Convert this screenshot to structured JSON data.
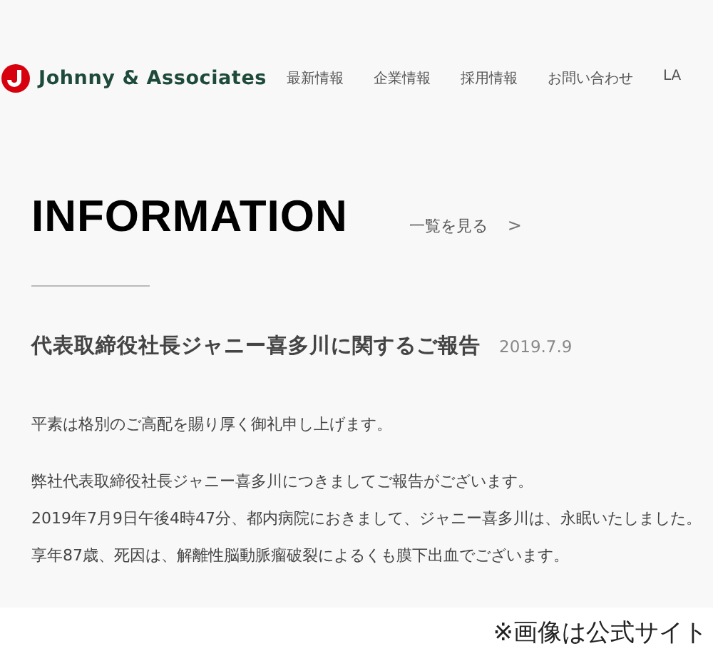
{
  "header": {
    "logo_text": "Johnny & Associates",
    "nav": [
      {
        "label": "最新情報"
      },
      {
        "label": "企業情報"
      },
      {
        "label": "採用情報"
      },
      {
        "label": "お問い合わせ"
      },
      {
        "label": "LA"
      }
    ]
  },
  "section": {
    "heading": "INFORMATION",
    "list_link": "一覧を見る",
    "list_link_arrow": ">"
  },
  "article": {
    "title": "代表取締役社長ジャニー喜多川に関するご報告",
    "date": "2019.7.9",
    "paragraphs": [
      [
        "平素は格別のご高配を賜り厚く御礼申し上げます。"
      ],
      [
        "弊社代表取締役社長ジャニー喜多川につきましてご報告がございます。",
        "2019年7月9日午後4時47分、都内病院におきまして、ジャニー喜多川は、永眠いたしました。",
        "享年87歳、死因は、解離性脳動脈瘤破裂によるくも膜下出血でございます。"
      ]
    ]
  },
  "caption": "※画像は公式サイト"
}
